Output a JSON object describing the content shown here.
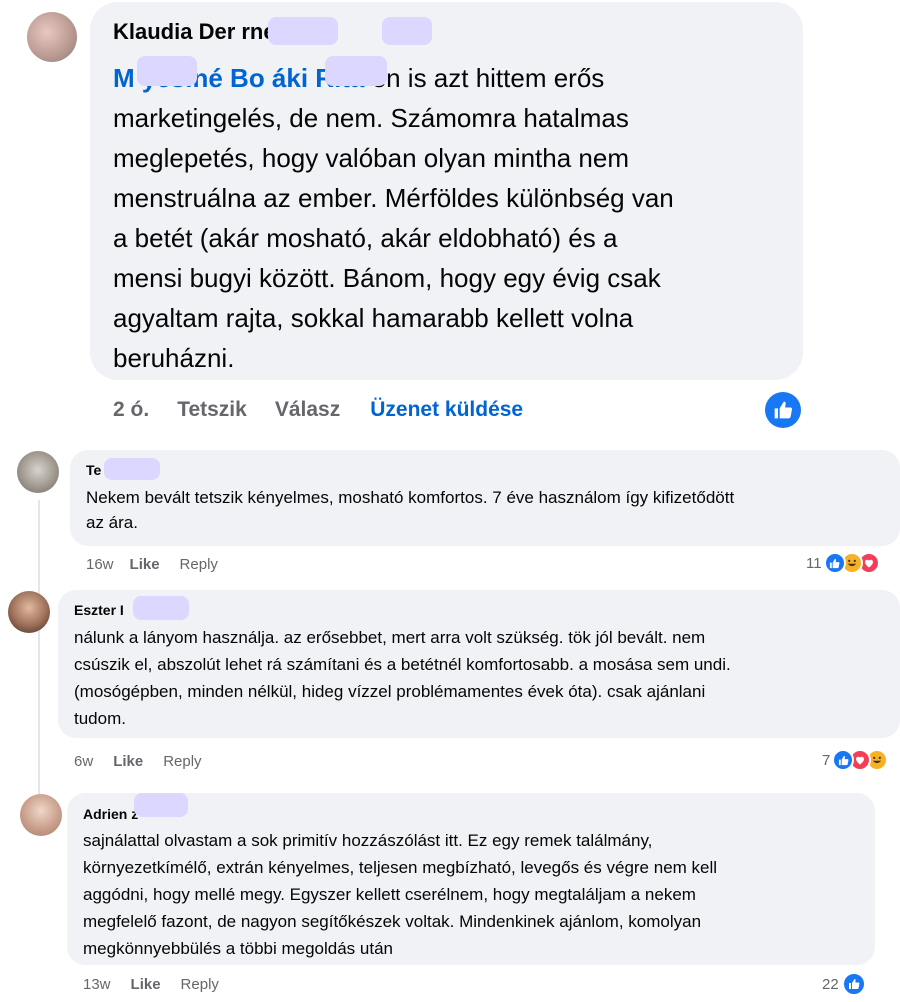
{
  "comment1": {
    "author": "Klaudia Der   rné S   s",
    "mention": "M   yesiné Bo   áki Rita",
    "text": " én is azt hittem erős marketingelés, de nem. Számomra hatalmas meglepetés, hogy valóban olyan mintha nem menstruálna az ember. Mérföldes különbség van a betét (akár mosható, akár eldobható) és a mensi bugyi között. Bánom, hogy egy évig csak agyaltam rajta, sokkal hamarabb kellett volna beruházni.",
    "lines": [
      "marketingelés, de nem. Számomra hatalmas",
      "meglepetés, hogy valóban olyan mintha nem",
      "menstruálna az ember. Mérföldes különbség van",
      "a betét (akár mosható, akár eldobható) és a",
      "mensi bugyi között. Bánom, hogy egy évig csak",
      "agyaltam rajta, sokkal hamarabb kellett volna",
      "beruházni."
    ],
    "first_line_rest": " én is azt hittem erős",
    "time": "2 ó.",
    "like_label": "Tetszik",
    "reply_label": "Válasz",
    "message_label": "Üzenet küldése"
  },
  "comment2": {
    "author": "Te",
    "line1": "Nekem bevált tetszik kényelmes, mosható komfortos. 7 éve használom így kifizetődött",
    "line2": "az ára.",
    "time": "16w",
    "like_label": "Like",
    "reply_label": "Reply",
    "reaction_count": "11"
  },
  "comment3": {
    "author": "Eszter I",
    "line1": "nálunk a lányom használja. az erősebbet, mert arra volt szükség. tök jól bevált. nem",
    "line2": "csúszik el, abszolút lehet rá számítani és a betétnél komfortosabb. a mosása sem undi.",
    "line3": "(mosógépben, minden nélkül, hideg vízzel problémamentes évek óta). csak ajánlani",
    "line4": "tudom.",
    "time": "6w",
    "like_label": "Like",
    "reply_label": "Reply",
    "reaction_count": "7"
  },
  "comment4": {
    "author": "Adrien   z",
    "line1": "sajnálattal olvastam a sok primitív hozzászólást itt. Ez egy remek találmány,",
    "line2": "környezetkímélő, extrán kényelmes, teljesen megbízható, levegős és végre nem kell",
    "line3": "aggódni, hogy mellé megy. Egyszer kellett cserélnem, hogy megtaláljam a nekem",
    "line4": "megfelelő fazont, de nagyon segítőkészek voltak. Mindenkinek ajánlom, komolyan",
    "line5": "megkönnyebbülés a többi megoldás után",
    "time": "13w",
    "like_label": "Like",
    "reply_label": "Reply",
    "reaction_count": "22"
  },
  "colors": {
    "bubble": "#f0f2f5",
    "link": "#0064d1",
    "muted": "#65676b",
    "like_blue": "#1877f2"
  }
}
